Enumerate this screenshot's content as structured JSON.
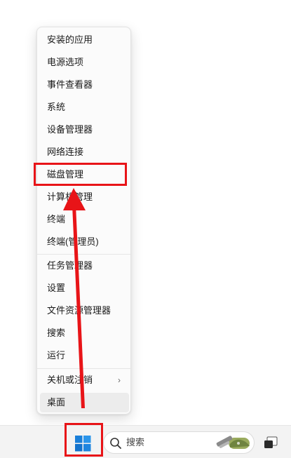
{
  "context_menu": {
    "items": [
      {
        "label": "安装的应用"
      },
      {
        "label": "电源选项"
      },
      {
        "label": "事件查看器"
      },
      {
        "label": "系统"
      },
      {
        "label": "设备管理器"
      },
      {
        "label": "网络连接"
      },
      {
        "label": "磁盘管理"
      },
      {
        "label": "计算机管理"
      },
      {
        "label": "终端"
      },
      {
        "label": "终端(管理员)"
      },
      {
        "label": "任务管理器"
      },
      {
        "label": "设置"
      },
      {
        "label": "文件资源管理器"
      },
      {
        "label": "搜索"
      },
      {
        "label": "运行"
      },
      {
        "label": "关机或注销",
        "has_submenu": true,
        "chevron": "›"
      },
      {
        "label": "桌面"
      }
    ]
  },
  "taskbar": {
    "search_placeholder": "搜索",
    "start_icon": "windows-logo-icon",
    "taskview_icon": "task-view-icon"
  },
  "annotation": {
    "color": "#e81418"
  }
}
